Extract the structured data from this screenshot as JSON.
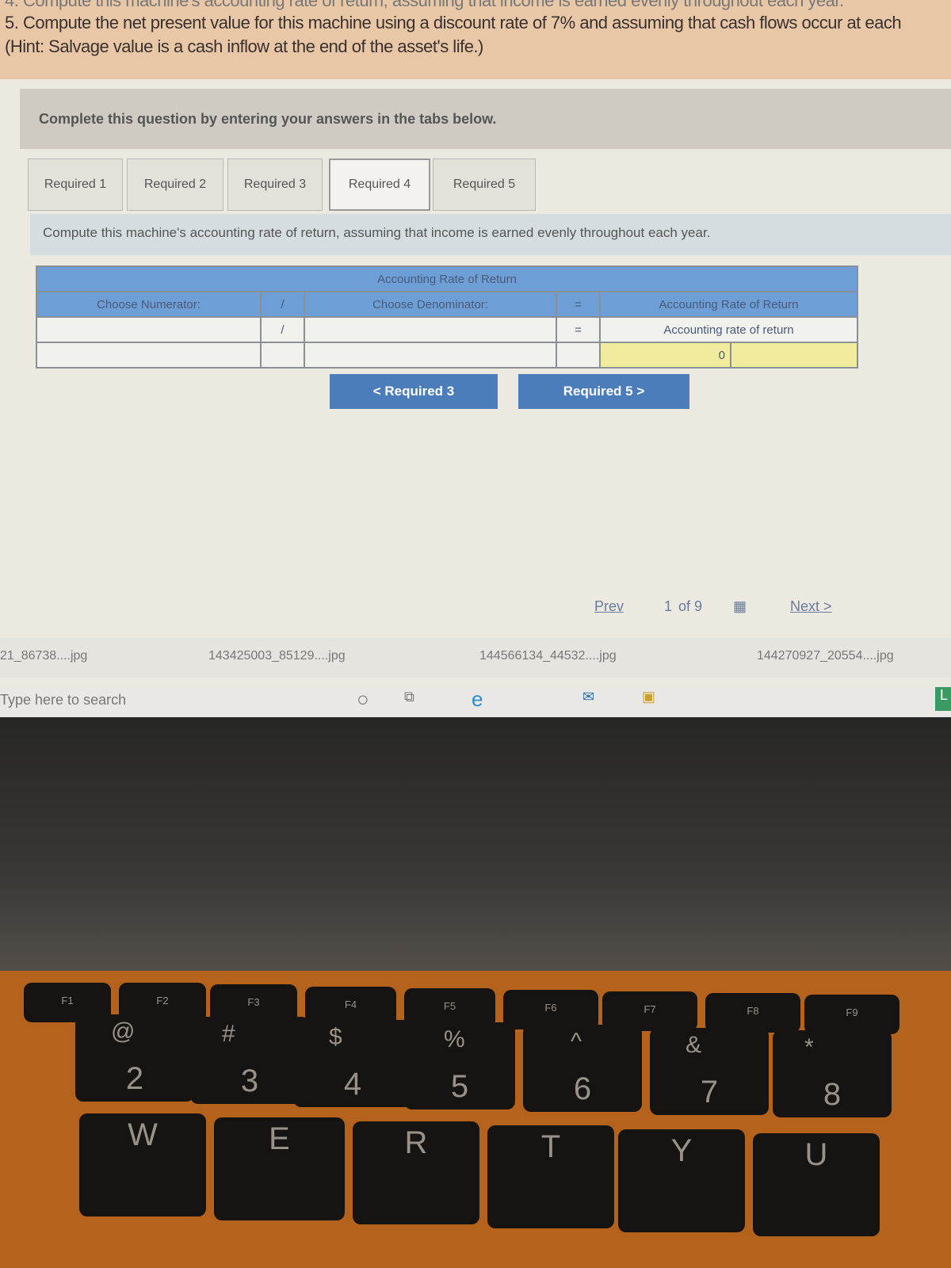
{
  "question": {
    "line4": "4. Compute this machine's accounting rate of return, assuming that income is earned evenly throughout each year.",
    "line5": "5. Compute the net present value for this machine using a discount rate of 7% and assuming that cash flows occur at each",
    "hint": "(Hint: Salvage value is a cash inflow at the end of the asset's life.)"
  },
  "instruction": "Complete this question by entering your answers in the tabs below.",
  "tabs": [
    "Required 1",
    "Required 2",
    "Required 3",
    "Required 4",
    "Required 5"
  ],
  "active_tab": "Required 4",
  "prompt": "Compute this machine's accounting rate of return, assuming that income is earned evenly throughout each year.",
  "table": {
    "title": "Accounting Rate of Return",
    "numerator_header": "Choose Numerator:",
    "divide": "/",
    "denominator_header": "Choose Denominator:",
    "equals": "=",
    "result_header": "Accounting Rate of Return",
    "result_label": "Accounting rate of return",
    "result_value": "0"
  },
  "nav": {
    "prev_button": "< Required 3",
    "next_button": "Required 5 >"
  },
  "pager": {
    "prev": "Prev",
    "page": "1",
    "of": "of 9",
    "next": "Next >"
  },
  "downloads": [
    "21_86738....jpg",
    "143425003_85129....jpg",
    "144566134_44532....jpg",
    "144270927_20554....jpg"
  ],
  "taskbar": {
    "search_placeholder": "Type here to search"
  },
  "keyboard": {
    "fkeys": [
      "F1",
      "F2",
      "F3",
      "F4",
      "F5",
      "F6",
      "F7",
      "F8",
      "F9"
    ],
    "number_keys": [
      "2",
      "3",
      "4",
      "5",
      "6",
      "7",
      "8"
    ],
    "symbols": [
      "@",
      "#",
      "$",
      "%",
      "^",
      "&",
      "*"
    ],
    "letters": [
      "W",
      "E",
      "R",
      "T",
      "Y",
      "U"
    ]
  },
  "colors": {
    "header_blue": "#6d9fd6",
    "button_blue": "#4b7dbb",
    "result_yellow": "#f1eb9d"
  }
}
